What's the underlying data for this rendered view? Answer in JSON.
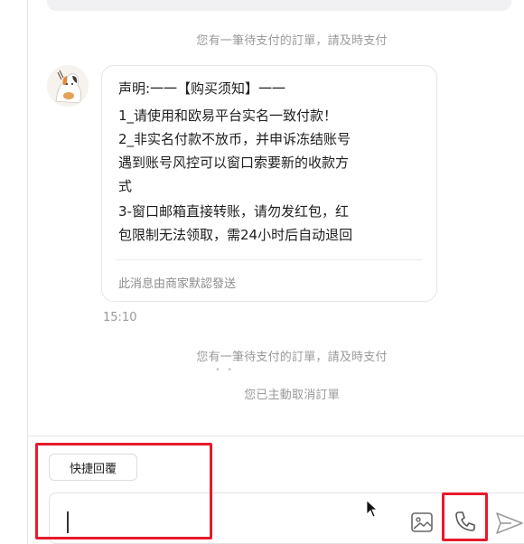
{
  "chat": {
    "system_notice_pending": "您有一筆待支付的訂單，請及時支付",
    "system_notice_pending_2": "您有一筆待支付的訂單，請及時支付",
    "system_notice_cancelled": "您已主動取消訂單",
    "message": {
      "lines": [
        "声明:一一【购买须知】一一",
        "1_请使用和欧易平台实名一致付款！",
        "2_非实名付款不放币，并申诉冻结账号",
        "遇到账号风控可以窗口索要新的收款方",
        "式",
        "3-窗口邮箱直接转账，请勿发红包，红",
        "包限制无法领取，需24小时后自动退回"
      ],
      "footer": "此消息由商家默認發送",
      "time": "15:10"
    }
  },
  "composer": {
    "quick_reply_label": "快捷回覆",
    "input_value": "",
    "icons": [
      "image-icon",
      "phone-icon",
      "send-icon"
    ]
  },
  "highlight_color": "#e8192c"
}
